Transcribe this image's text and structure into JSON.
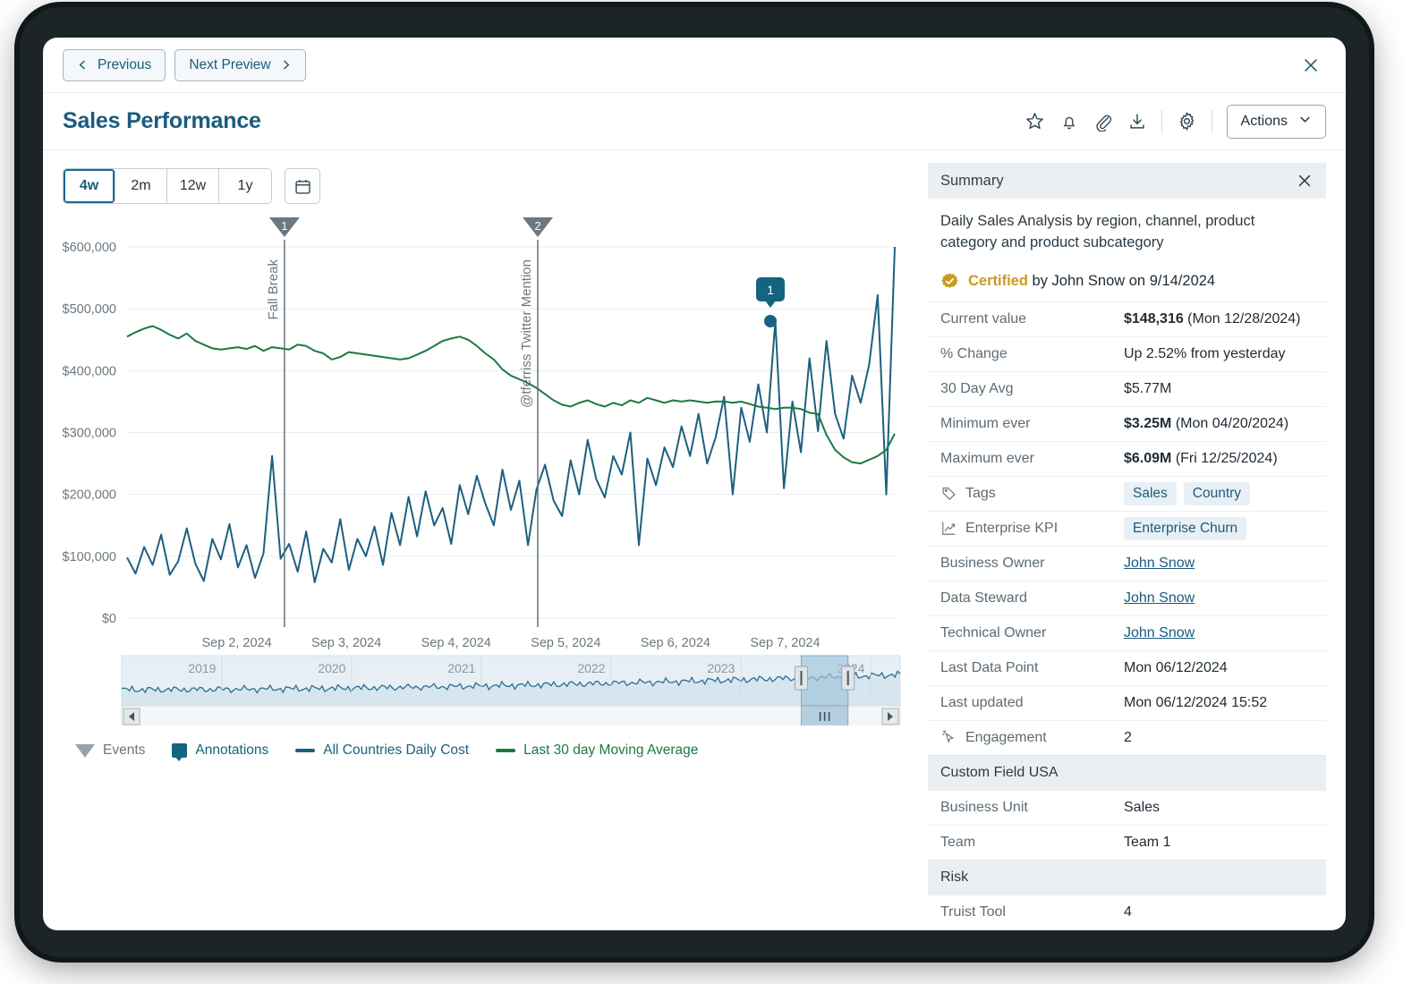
{
  "nav": {
    "previous_label": "Previous",
    "next_label": "Next Preview",
    "close_icon": "close-icon"
  },
  "header": {
    "title": "Sales Performance",
    "icons": [
      "star-icon",
      "bell-icon",
      "paperclip-icon",
      "download-icon",
      "gear-icon"
    ],
    "actions_label": "Actions"
  },
  "toolbar": {
    "ranges": [
      {
        "label": "4w",
        "active": true
      },
      {
        "label": "2m",
        "active": false
      },
      {
        "label": "12w",
        "active": false
      },
      {
        "label": "1y",
        "active": false
      }
    ],
    "calendar_icon": "calendar-icon"
  },
  "legend": [
    {
      "label": "Events",
      "color": "#9aa3a9",
      "kind": "triangle"
    },
    {
      "label": "Annotations",
      "color": "#14637f",
      "kind": "marker"
    },
    {
      "label": "All Countries Daily Cost",
      "color": "#1c6080",
      "kind": "line"
    },
    {
      "label": "Last 30 day Moving Average",
      "color": "#1a7a42",
      "kind": "line"
    }
  ],
  "chart_data": {
    "type": "line",
    "title": "",
    "xlabel": "",
    "ylabel": "",
    "ylim": [
      0,
      600000
    ],
    "ytick_labels": [
      "$600,000",
      "$500,000",
      "$400,000",
      "$300,000",
      "$200,000",
      "$100,000",
      "$0"
    ],
    "yticks": [
      600000,
      500000,
      400000,
      300000,
      200000,
      100000,
      0
    ],
    "xtick_labels": [
      "Sep 2, 2024",
      "Sep 3, 2024",
      "Sep 4, 2024",
      "Sep 5, 2024",
      "Sep 6, 2024",
      "Sep 7, 2024"
    ],
    "grid": true,
    "legend_position": "bottom",
    "series": [
      {
        "name": "All Countries Daily Cost",
        "color": "#1c6080",
        "values": [
          98000,
          72000,
          115000,
          86000,
          135000,
          70000,
          92000,
          145000,
          88000,
          60000,
          128000,
          95000,
          152000,
          82000,
          118000,
          65000,
          105000,
          262000,
          96000,
          120000,
          75000,
          140000,
          58000,
          112000,
          90000,
          160000,
          78000,
          128000,
          100000,
          148000,
          86000,
          170000,
          118000,
          196000,
          132000,
          205000,
          150000,
          178000,
          120000,
          215000,
          168000,
          230000,
          185000,
          150000,
          240000,
          175000,
          222000,
          118000,
          208000,
          248000,
          190000,
          165000,
          255000,
          200000,
          288000,
          225000,
          195000,
          262000,
          232000,
          300000,
          118000,
          258000,
          215000,
          276000,
          244000,
          310000,
          262000,
          330000,
          250000,
          292000,
          358000,
          200000,
          340000,
          285000,
          378000,
          300000,
          480000,
          210000,
          350000,
          268000,
          420000,
          302000,
          448000,
          330000,
          290000,
          392000,
          348000,
          410000,
          522000,
          200000,
          600000
        ],
        "annotation_point_index": 76
      },
      {
        "name": "Last 30 day Moving Average",
        "color": "#1a7a42",
        "values": [
          455000,
          462000,
          468000,
          472000,
          466000,
          458000,
          452000,
          460000,
          448000,
          442000,
          436000,
          434000,
          436000,
          438000,
          435000,
          440000,
          432000,
          438000,
          436000,
          434000,
          442000,
          440000,
          432000,
          428000,
          418000,
          422000,
          430000,
          428000,
          426000,
          424000,
          422000,
          420000,
          418000,
          420000,
          426000,
          432000,
          440000,
          448000,
          452000,
          455000,
          450000,
          440000,
          428000,
          418000,
          402000,
          392000,
          386000,
          380000,
          372000,
          362000,
          352000,
          345000,
          342000,
          348000,
          352000,
          346000,
          342000,
          348000,
          344000,
          352000,
          348000,
          356000,
          352000,
          348000,
          352000,
          350000,
          352000,
          350000,
          348000,
          350000,
          350000,
          348000,
          350000,
          346000,
          342000,
          340000,
          338000,
          340000,
          340000,
          338000,
          332000,
          330000,
          296000,
          272000,
          260000,
          252000,
          250000,
          256000,
          262000,
          272000,
          298000
        ]
      }
    ],
    "events": [
      {
        "number": "1",
        "label": "Fall Break",
        "x_ratio": 0.205
      },
      {
        "number": "2",
        "label": "@tferriss Twitter Mention",
        "x_ratio": 0.535
      }
    ],
    "annotations": [
      {
        "number": "1",
        "x_ratio": 0.838,
        "value": 480000
      }
    ]
  },
  "navigator": {
    "year_labels": [
      "2019",
      "2020",
      "2021",
      "2022",
      "2023",
      "2024"
    ],
    "selection_start_ratio": 0.873,
    "selection_end_ratio": 0.933,
    "scroll_left_icon": "arrow-left-icon",
    "scroll_right_icon": "arrow-right-icon",
    "grip_icon": "grip-icon"
  },
  "summary": {
    "title": "Summary",
    "close_icon": "close-icon",
    "description": "Daily Sales Analysis by region, channel, product category and product subcategory",
    "certified": {
      "icon": "certified-badge-icon",
      "word": "Certified",
      "rest": " by John Snow on 9/14/2024"
    },
    "rows": [
      {
        "label": "Current value",
        "value_bold": "$148,316",
        "value_rest": " (Mon 12/28/2024)"
      },
      {
        "label": "% Change",
        "value": "Up 2.52% from yesterday"
      },
      {
        "label": "30 Day Avg",
        "value": "$5.77M"
      },
      {
        "label": "Minimum ever",
        "value_bold": "$3.25M",
        "value_rest": " (Mon 04/20/2024)"
      },
      {
        "label": "Maximum ever",
        "value_bold": "$6.09M",
        "value_rest": " (Fri 12/25/2024)"
      },
      {
        "label": "Tags",
        "icon": "tag-icon",
        "chips": [
          "Sales",
          "Country"
        ]
      },
      {
        "label": "Enterprise KPI",
        "icon": "trending-up-icon",
        "chips": [
          "Enterprise Churn"
        ]
      },
      {
        "label": "Business Owner",
        "link": "John Snow"
      },
      {
        "label": "Data Steward",
        "link": "John Snow"
      },
      {
        "label": "Technical Owner",
        "link": "John Snow"
      },
      {
        "label": "Last Data Point",
        "value": "Mon 06/12/2024"
      },
      {
        "label": "Last updated",
        "value": "Mon 06/12/2024  15:52"
      },
      {
        "label": "Engagement",
        "icon": "cursor-click-icon",
        "value": "2"
      },
      {
        "label": "Custom Field USA",
        "section": true
      },
      {
        "label": "Business Unit",
        "value": "Sales"
      },
      {
        "label": "Team",
        "value": "Team 1"
      },
      {
        "label": "Risk",
        "section": true
      },
      {
        "label": "Truist Tool",
        "value": "4"
      }
    ]
  },
  "colors": {
    "accent": "#1a5b7e",
    "line_primary": "#1c6080",
    "line_average": "#1a7a42",
    "certified": "#c99a1e"
  }
}
